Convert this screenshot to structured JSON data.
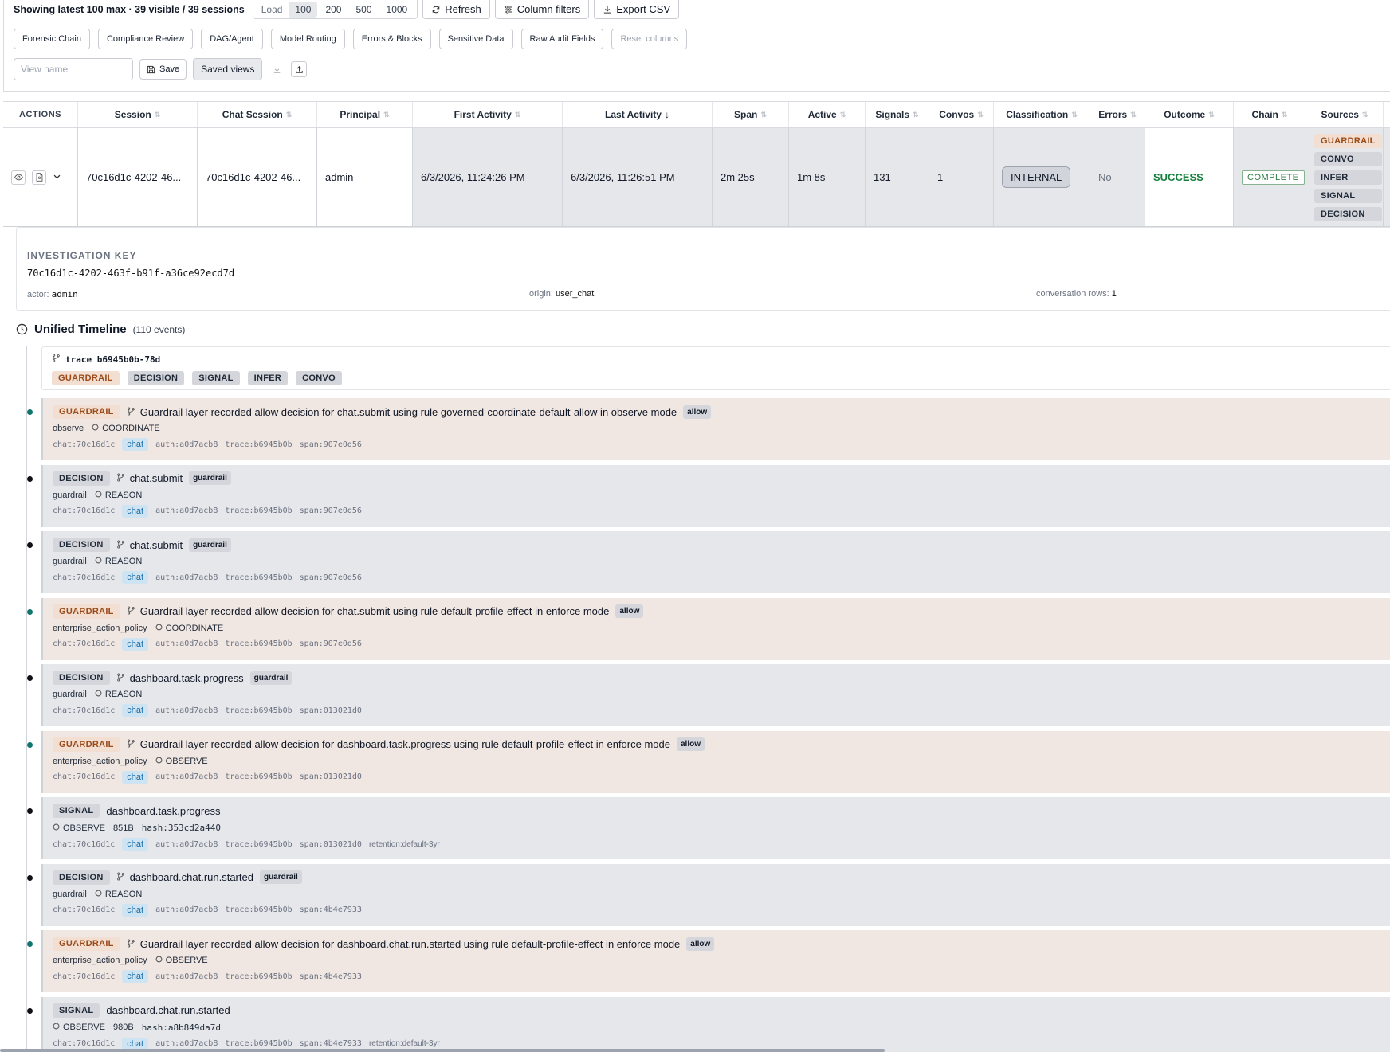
{
  "toolbar": {
    "summary": "Showing latest 100 max · 39 visible / 39 sessions",
    "load_label": "Load",
    "load_options": [
      "100",
      "200",
      "500",
      "1000"
    ],
    "load_selected": "100",
    "refresh": "Refresh",
    "column_filters": "Column filters",
    "export_csv": "Export CSV"
  },
  "presets": [
    "Forensic Chain",
    "Compliance Review",
    "DAG/Agent",
    "Model Routing",
    "Errors & Blocks",
    "Sensitive Data",
    "Raw Audit Fields",
    "Reset columns"
  ],
  "views": {
    "placeholder": "View name",
    "save": "Save",
    "saved_views": "Saved views"
  },
  "columns": [
    "ACTIONS",
    "Session",
    "Chat Session",
    "Principal",
    "First Activity",
    "Last Activity",
    "Span",
    "Active",
    "Signals",
    "Convos",
    "Classification",
    "Errors",
    "Outcome",
    "Chain",
    "Sources"
  ],
  "sort_indicator": "↓",
  "row": {
    "session": "70c16d1c-4202-46...",
    "chat_session": "70c16d1c-4202-46...",
    "principal": "admin",
    "first_activity": "6/3/2026, 11:24:26 PM",
    "last_activity": "6/3/2026, 11:26:51 PM",
    "span": "2m 25s",
    "active": "1m 8s",
    "signals": "131",
    "convos": "1",
    "classification": "INTERNAL",
    "errors": "No",
    "outcome": "SUCCESS",
    "chain": "COMPLETE",
    "sources": [
      "GUARDRAIL",
      "CONVO",
      "INFER",
      "SIGNAL",
      "DECISION"
    ]
  },
  "investigation": {
    "title": "INVESTIGATION KEY",
    "key": "70c16d1c-4202-463f-b91f-a36ce92ecd7d",
    "actor_label": "actor:",
    "actor": "admin",
    "origin_label": "origin:",
    "origin": "user_chat",
    "rows_label": "conversation rows:",
    "rows": "1"
  },
  "timeline": {
    "title": "Unified Timeline",
    "count": "(110 events)",
    "trace_label": "trace b6945b0b-78d",
    "trace_badges": [
      "GUARDRAIL",
      "DECISION",
      "SIGNAL",
      "INFER",
      "CONVO"
    ]
  },
  "events": [
    {
      "kind": "GUARDRAIL",
      "title": "Guardrail layer recorded allow decision for chat.submit using rule governed-coordinate-default-allow in observe mode",
      "tag": "allow",
      "sub1": "observe",
      "sub2": "COORDINATE",
      "chat": "chat:70c16d1c",
      "auth": "auth:a0d7acb8",
      "trace": "trace:b6945b0b",
      "span": "span:907e0d56"
    },
    {
      "kind": "DECISION",
      "title": "chat.submit",
      "tag": "guardrail",
      "sub1": "guardrail",
      "sub2": "REASON",
      "chat": "chat:70c16d1c",
      "auth": "auth:a0d7acb8",
      "trace": "trace:b6945b0b",
      "span": "span:907e0d56"
    },
    {
      "kind": "DECISION",
      "title": "chat.submit",
      "tag": "guardrail",
      "sub1": "guardrail",
      "sub2": "REASON",
      "chat": "chat:70c16d1c",
      "auth": "auth:a0d7acb8",
      "trace": "trace:b6945b0b",
      "span": "span:907e0d56"
    },
    {
      "kind": "GUARDRAIL",
      "title": "Guardrail layer recorded allow decision for chat.submit using rule default-profile-effect in enforce mode",
      "tag": "allow",
      "sub1": "enterprise_action_policy",
      "sub2": "COORDINATE",
      "chat": "chat:70c16d1c",
      "auth": "auth:a0d7acb8",
      "trace": "trace:b6945b0b",
      "span": "span:907e0d56"
    },
    {
      "kind": "DECISION",
      "title": "dashboard.task.progress",
      "tag": "guardrail",
      "sub1": "guardrail",
      "sub2": "REASON",
      "chat": "chat:70c16d1c",
      "auth": "auth:a0d7acb8",
      "trace": "trace:b6945b0b",
      "span": "span:013021d0"
    },
    {
      "kind": "GUARDRAIL",
      "title": "Guardrail layer recorded allow decision for dashboard.task.progress using rule default-profile-effect in enforce mode",
      "tag": "allow",
      "sub1": "enterprise_action_policy",
      "sub2": "OBSERVE",
      "chat": "chat:70c16d1c",
      "auth": "auth:a0d7acb8",
      "trace": "trace:b6945b0b",
      "span": "span:013021d0"
    },
    {
      "kind": "SIGNAL",
      "title": "dashboard.task.progress",
      "sub2": "OBSERVE",
      "size": "851B",
      "hash": "hash:353cd2a440",
      "chat": "chat:70c16d1c",
      "auth": "auth:a0d7acb8",
      "trace": "trace:b6945b0b",
      "span": "span:013021d0",
      "retention": "retention:default-3yr"
    },
    {
      "kind": "DECISION",
      "title": "dashboard.chat.run.started",
      "tag": "guardrail",
      "sub1": "guardrail",
      "sub2": "REASON",
      "chat": "chat:70c16d1c",
      "auth": "auth:a0d7acb8",
      "trace": "trace:b6945b0b",
      "span": "span:4b4e7933"
    },
    {
      "kind": "GUARDRAIL",
      "title": "Guardrail layer recorded allow decision for dashboard.chat.run.started using rule default-profile-effect in enforce mode",
      "tag": "allow",
      "sub1": "enterprise_action_policy",
      "sub2": "OBSERVE",
      "chat": "chat:70c16d1c",
      "auth": "auth:a0d7acb8",
      "trace": "trace:b6945b0b",
      "span": "span:4b4e7933"
    },
    {
      "kind": "SIGNAL",
      "title": "dashboard.chat.run.started",
      "sub2": "OBSERVE",
      "size": "980B",
      "hash": "hash:a8b849da7d",
      "chat": "chat:70c16d1c",
      "auth": "auth:a0d7acb8",
      "trace": "trace:b6945b0b",
      "span": "span:4b4e7933",
      "retention": "retention:default-3yr"
    }
  ],
  "chat_chip": "chat"
}
